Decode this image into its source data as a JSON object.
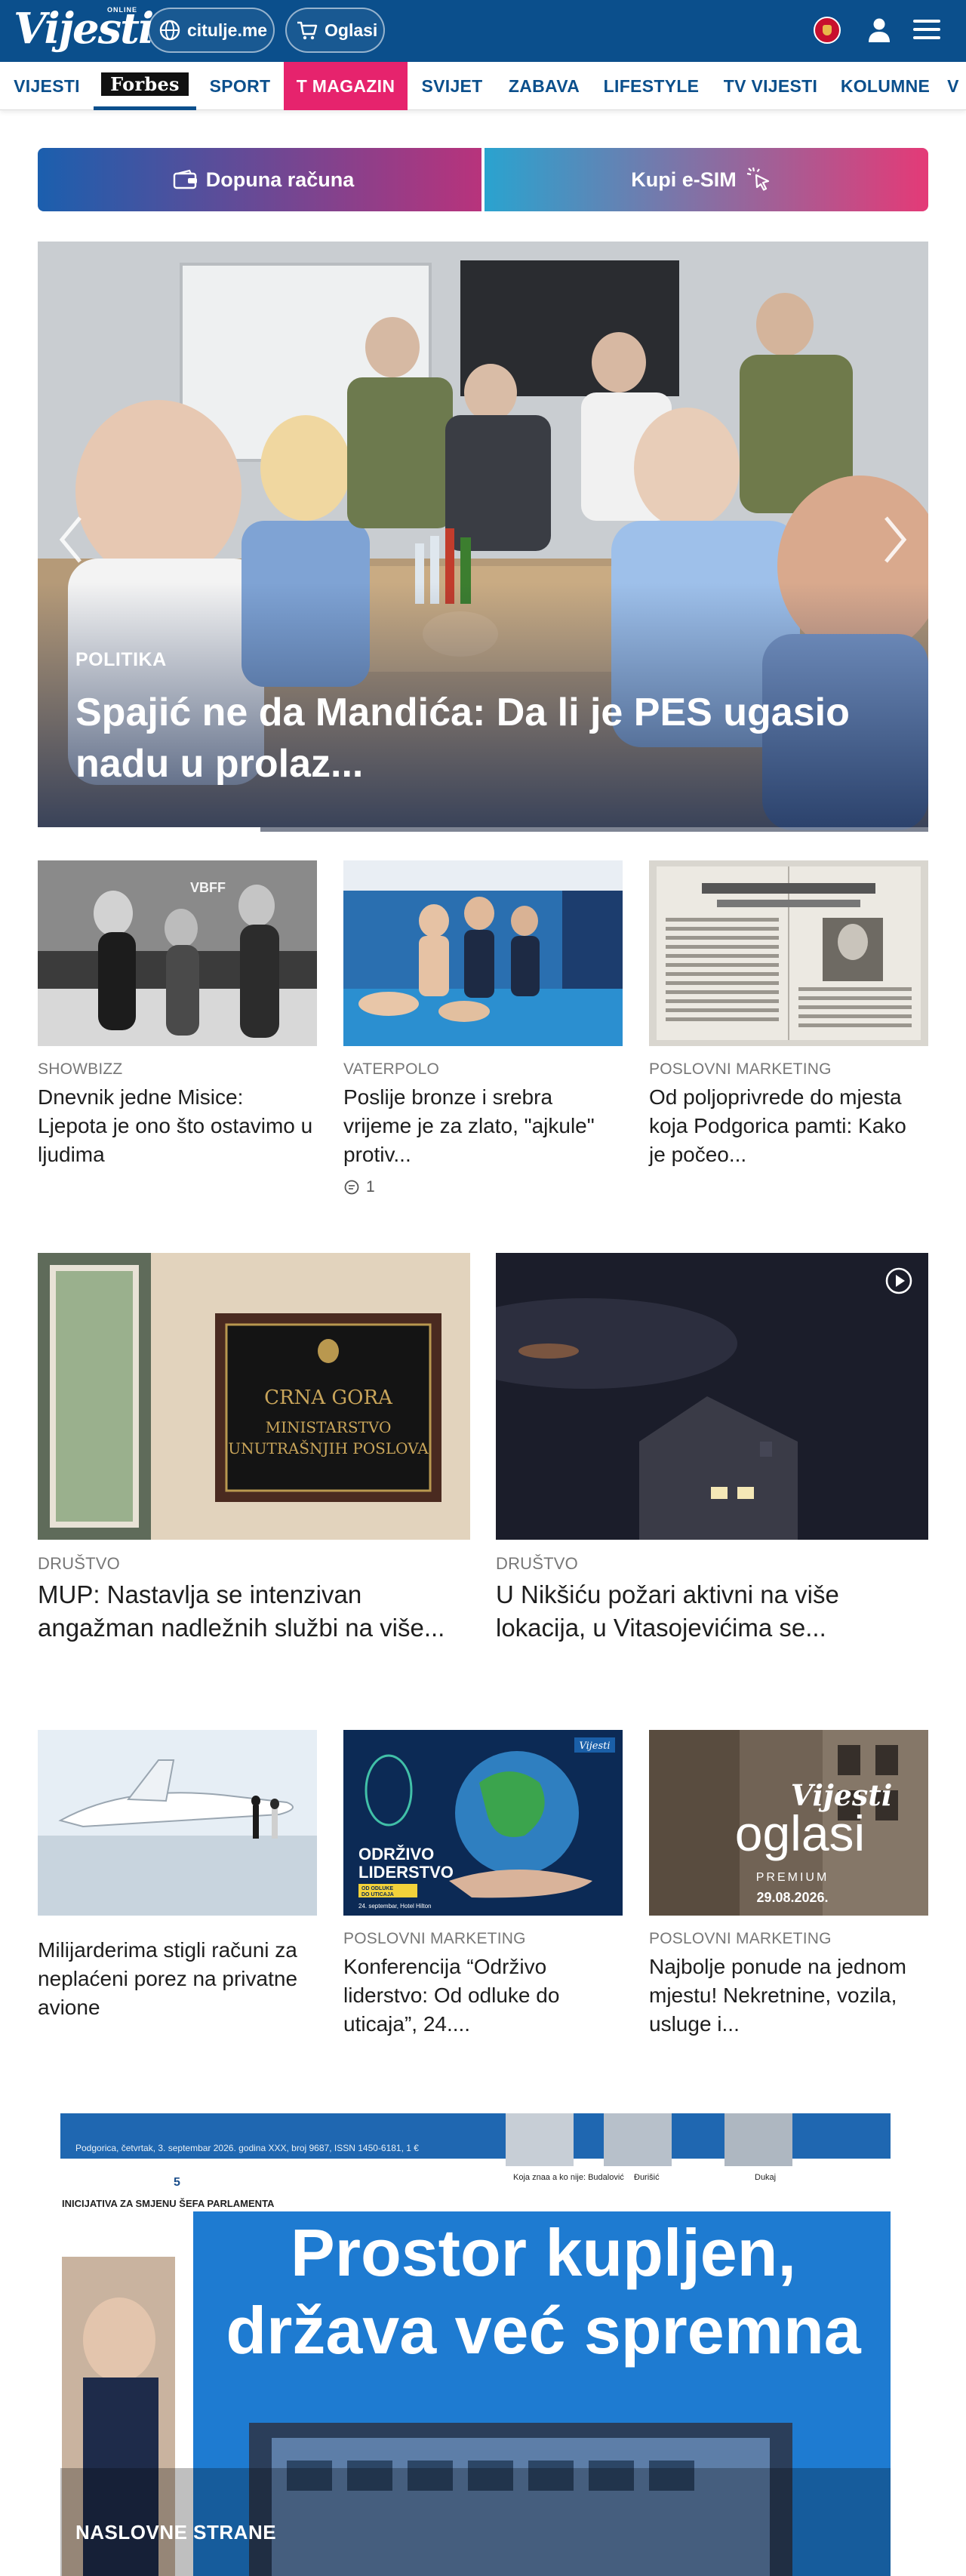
{
  "header": {
    "logo_text": "Vijesti",
    "logo_sub": "ONLINE",
    "pills": [
      {
        "label": "citulje.me",
        "icon": "globe-icon"
      },
      {
        "label": "Oglasi",
        "icon": "cart-icon"
      }
    ],
    "icons": [
      "montenegro-flag-icon",
      "user-icon",
      "hamburger-menu-icon"
    ],
    "colors": {
      "brand": "#0b4f8c",
      "tmagazin": "#e6236d"
    }
  },
  "nav": {
    "items": [
      {
        "label": "VIJESTI"
      },
      {
        "label": "Forbes"
      },
      {
        "label": "SPORT"
      },
      {
        "label": "T MAGAZIN"
      },
      {
        "label": "SVIJET"
      },
      {
        "label": "ZABAVA"
      },
      {
        "label": "LIFESTYLE"
      },
      {
        "label": "TV VIJESTI"
      },
      {
        "label": "KOLUMNE"
      },
      {
        "label": "V"
      }
    ]
  },
  "cta": {
    "topup": {
      "label": "Dopuna računa",
      "icon": "wallet-icon"
    },
    "esim": {
      "label": "Kupi e-SIM",
      "icon": "cursor-click-icon"
    }
  },
  "hero": {
    "category": "POLITIKA",
    "title": "Spajić ne da Mandića: Da li je PES ugasio nadu u prolaz...",
    "slide_progress": 0.25
  },
  "row1": [
    {
      "category": "SHOWBIZZ",
      "title": "Dnevnik jedne Misice: Ljepota je ono što ostavimo u ljudima"
    },
    {
      "category": "VATERPOLO",
      "title": "Poslije bronze i srebra vrijeme je za zlato, \"ajkule\" protiv...",
      "comments": "1"
    },
    {
      "category": "POSLOVNI MARKETING",
      "title": "Od poljoprivrede do mjesta koja Podgorica pamti: Kako je počeo..."
    }
  ],
  "row2": [
    {
      "category": "DRUŠTVO",
      "title": "MUP: Nastavlja se intenzivan angažman nadležnih službi na više...",
      "sign_lines": [
        "CRNA GORA",
        "MINISTARSTVO",
        "UNUTRAŠNJIH POSLOVA"
      ]
    },
    {
      "category": "DRUŠTVO",
      "title": "U Nikšiću požari aktivni na više lokacija, u Vitasojevićima se...",
      "video": true
    }
  ],
  "row3": [
    {
      "category": "",
      "title": "Milijarderima stigli računi za neplaćeni porez na privatne avione"
    },
    {
      "category": "POSLOVNI MARKETING",
      "title": "Konferencija “Održivo liderstvo: Od odluke do uticaja”, 24....",
      "poster": {
        "brand": "Vijesti",
        "line1": "ODRŽIVO",
        "line2": "LIDERSTVO",
        "line3": "OD ODLUKE",
        "line4": "DO UTICAJA",
        "date": "24. septembar, Hotel Hilton"
      }
    },
    {
      "category": "POSLOVNI MARKETING",
      "title": "Najbolje ponude na jednom mjestu! Nekretnine, vozila, usluge i...",
      "poster": {
        "brand": "Vijesti",
        "word": "oglasi",
        "tier": "PREMIUM",
        "date": "29.08.2026."
      }
    }
  ],
  "front_page": {
    "label": "NASLOVNE STRANE",
    "masthead_date": "Podgorica, četvrtak, 3. septembar 2026. godina XXX, broj 9687, ISSN 1450-6181, 1 €",
    "headline_1": "Prostor kupljen,",
    "headline_2": "država već spremna",
    "side_number": "5",
    "side_kicker": "INICIJATIVA ZA SMJENU ŠEFA PARLAMENTA",
    "side_caption": "Koja znaa a ko nije: Budalović",
    "thumb_labels": [
      "Đurišić",
      "Dukaj"
    ]
  }
}
